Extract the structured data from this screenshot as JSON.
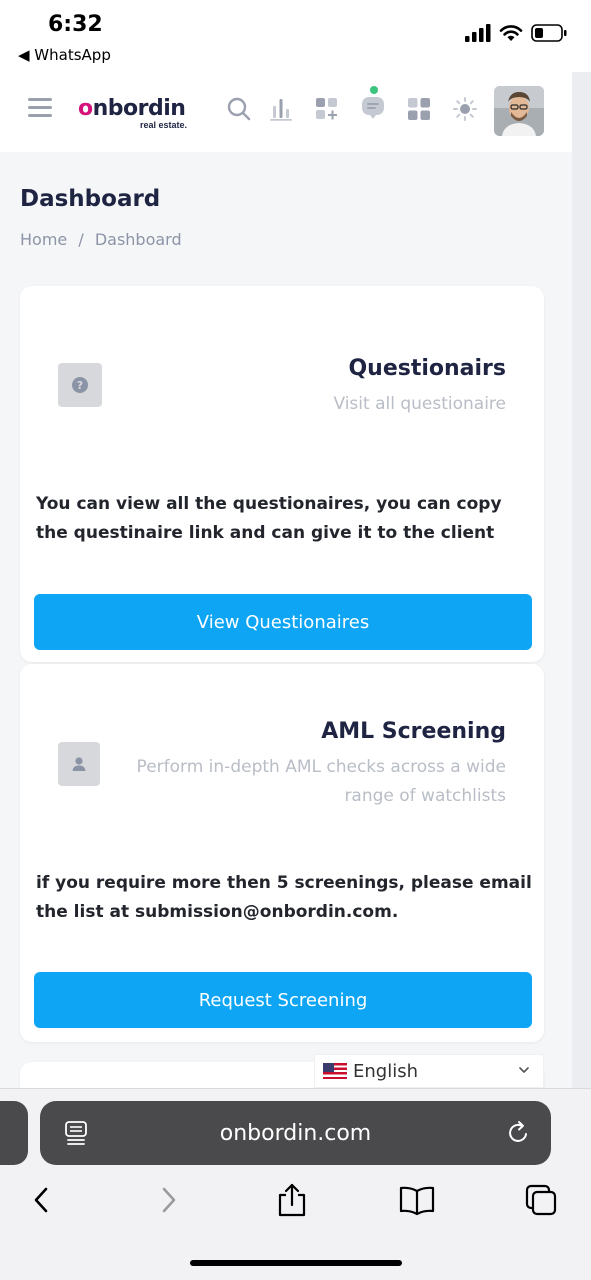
{
  "status_bar": {
    "time": "6:32",
    "back_label": "◀ WhatsApp"
  },
  "header": {
    "logo_main": "nbordin",
    "logo_sub": "real estate.",
    "icons": [
      "menu-icon",
      "search-icon",
      "chart-icon",
      "add-widget-icon",
      "chat-icon",
      "apps-icon",
      "brightness-icon"
    ],
    "chat_status_color": "#3cc47c"
  },
  "page": {
    "title": "Dashboard",
    "breadcrumb": [
      "Home",
      "/",
      "Dashboard"
    ]
  },
  "cards": [
    {
      "icon": "question-icon",
      "title": "Questionairs",
      "subtitle": "Visit all questionaire",
      "description": "You can view all the questionaires, you can copy the questinaire link and can give it to the client",
      "button_label": "View Questionaires"
    },
    {
      "icon": "user-icon",
      "title": "AML Screening",
      "subtitle": "Perform in-depth AML checks across a wide range of watchlists",
      "description": "if you require more then 5 screenings, please email the list at submission@onbordin.com.",
      "button_label": "Request Screening"
    }
  ],
  "language": {
    "selected": "English"
  },
  "browser": {
    "url": "onbordin.com"
  },
  "colors": {
    "accent_button": "#0ea5f5",
    "brand_pink": "#d5127a",
    "heading": "#1e2442"
  }
}
